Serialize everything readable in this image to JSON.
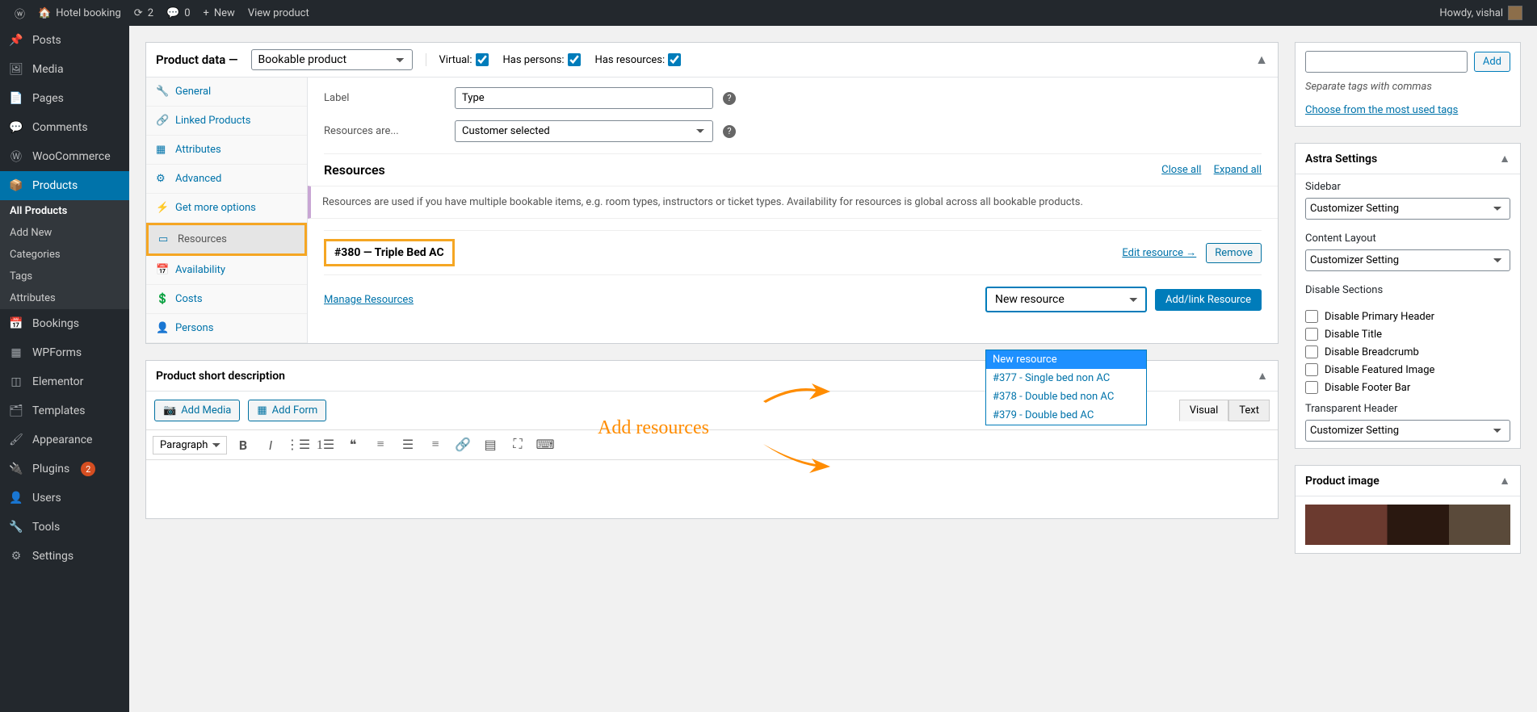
{
  "adminbar": {
    "site_name": "Hotel booking",
    "updates": "2",
    "comments": "0",
    "new_label": "New",
    "view_product": "View product",
    "howdy": "Howdy, vishal"
  },
  "sidebar": {
    "items": [
      {
        "icon": "pin",
        "label": "Posts"
      },
      {
        "icon": "media",
        "label": "Media"
      },
      {
        "icon": "page",
        "label": "Pages"
      },
      {
        "icon": "comment",
        "label": "Comments"
      },
      {
        "icon": "woo",
        "label": "WooCommerce"
      },
      {
        "icon": "archive",
        "label": "Products",
        "current": true
      },
      {
        "icon": "calendar",
        "label": "Bookings"
      },
      {
        "icon": "form",
        "label": "WPForms"
      },
      {
        "icon": "elementor",
        "label": "Elementor"
      },
      {
        "icon": "templates",
        "label": "Templates"
      },
      {
        "icon": "brush",
        "label": "Appearance"
      },
      {
        "icon": "plugin",
        "label": "Plugins",
        "badge": "2"
      },
      {
        "icon": "user",
        "label": "Users"
      },
      {
        "icon": "wrench",
        "label": "Tools"
      },
      {
        "icon": "gear",
        "label": "Settings"
      }
    ],
    "submenu": [
      {
        "label": "All Products",
        "current": true
      },
      {
        "label": "Add New"
      },
      {
        "label": "Categories"
      },
      {
        "label": "Tags"
      },
      {
        "label": "Attributes"
      }
    ]
  },
  "product_data": {
    "title": "Product data —",
    "type": "Bookable product",
    "virtual": "Virtual:",
    "has_persons": "Has persons:",
    "has_resources": "Has resources:",
    "tabs": [
      {
        "icon": "🔧",
        "label": "General"
      },
      {
        "icon": "🔗",
        "label": "Linked Products"
      },
      {
        "icon": "▦",
        "label": "Attributes"
      },
      {
        "icon": "⚙",
        "label": "Advanced"
      },
      {
        "icon": "⚡",
        "label": "Get more options"
      },
      {
        "icon": "▭",
        "label": "Resources",
        "active": true,
        "highlight": true
      },
      {
        "icon": "📅",
        "label": "Availability"
      },
      {
        "icon": "💲",
        "label": "Costs"
      },
      {
        "icon": "👤",
        "label": "Persons"
      }
    ],
    "label_field": {
      "label": "Label",
      "value": "Type"
    },
    "resources_are": {
      "label": "Resources are...",
      "value": "Customer selected"
    },
    "resources_heading": "Resources",
    "close_all": "Close all",
    "expand_all": "Expand all",
    "info_notice": "Resources are used if you have multiple bookable items, e.g. room types, instructors or ticket types. Availability for resources is global across all bookable products.",
    "resource_item": "#380 — Triple Bed AC",
    "edit_resource": "Edit resource →",
    "remove": "Remove",
    "manage_resources": "Manage Resources",
    "new_resource_placeholder": "New resource",
    "add_link": "Add/link Resource",
    "dropdown_options": [
      {
        "label": "New resource",
        "selected": true
      },
      {
        "label": "#377 - Single bed non AC"
      },
      {
        "label": "#378 - Double bed non AC"
      },
      {
        "label": "#379 - Double bed AC"
      }
    ]
  },
  "short_desc": {
    "title": "Product short description",
    "add_media": "Add Media",
    "add_form": "Add Form",
    "visual": "Visual",
    "text": "Text",
    "paragraph": "Paragraph"
  },
  "tags_box": {
    "add": "Add",
    "separate": "Separate tags with commas",
    "choose": "Choose from the most used tags"
  },
  "astra": {
    "title": "Astra Settings",
    "sidebar_label": "Sidebar",
    "customizer": "Customizer Setting",
    "content_layout": "Content Layout",
    "disable_sections": "Disable Sections",
    "checks": [
      "Disable Primary Header",
      "Disable Title",
      "Disable Breadcrumb",
      "Disable Featured Image",
      "Disable Footer Bar"
    ],
    "transparent_header": "Transparent Header"
  },
  "product_image": {
    "title": "Product image"
  },
  "annotation_text": "Add resources"
}
